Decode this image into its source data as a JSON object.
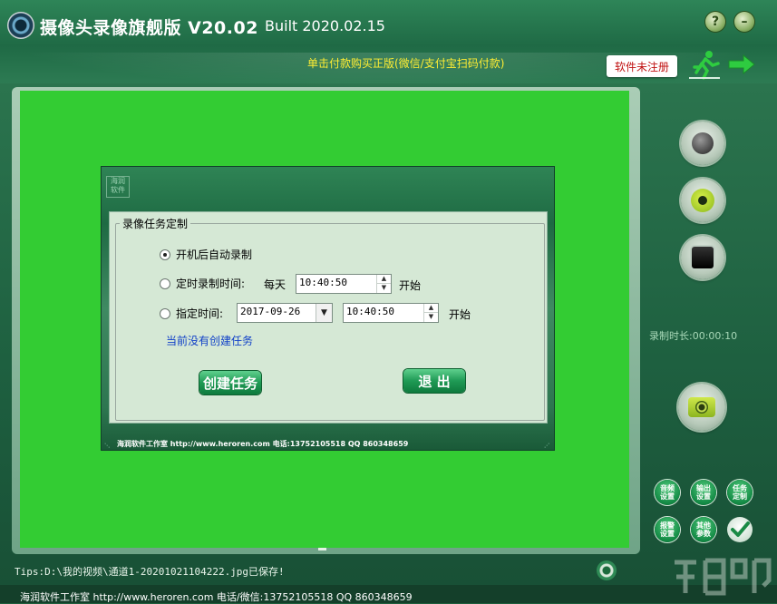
{
  "app": {
    "title": "摄像头录像旗舰版 V20.02",
    "built": "Built 2020.02.15",
    "help_label": "?",
    "minimize_label": "–",
    "promo": "单击付款购买正版(微信/支付宝扫码付款)",
    "unregistered": "软件未注册"
  },
  "dialog": {
    "logo_text": "海润\n软件",
    "group_title": "录像任务定制",
    "options": [
      {
        "label": "开机后自动录制",
        "selected": true
      },
      {
        "label": "定时录制时间:",
        "selected": false
      },
      {
        "label": "指定时间:",
        "selected": false
      }
    ],
    "every_day": "每天",
    "timer_time": "10:40:50",
    "start1": "开始",
    "date": "2017-09-26",
    "specified_time": "10:40:50",
    "start2": "开始",
    "status": "当前没有创建任务",
    "create_button": "创建任务",
    "exit_button": "退 出",
    "footer": "海润软件工作室  http://www.heroren.com  电话:13752105518  QQ 860348659"
  },
  "side": {
    "record_time": "录制时长:00:00:10",
    "small_buttons": [
      {
        "label": "音频\n设置"
      },
      {
        "label": "输出\n设置"
      },
      {
        "label": "任务\n定制"
      },
      {
        "label": "报警\n设置"
      },
      {
        "label": "其他\n参数"
      }
    ]
  },
  "status_bar": {
    "tips": "Tips:D:\\我的视频\\通道1-20201021104222.jpg已保存!",
    "footer": "海润软件工作室 http://www.heroren.com  电话/微信:13752105518  QQ 860348659"
  },
  "colors": {
    "preview": "#33cc33",
    "promo": "#ffee33",
    "status_link": "#1040c8",
    "unregistered": "#c01010"
  }
}
